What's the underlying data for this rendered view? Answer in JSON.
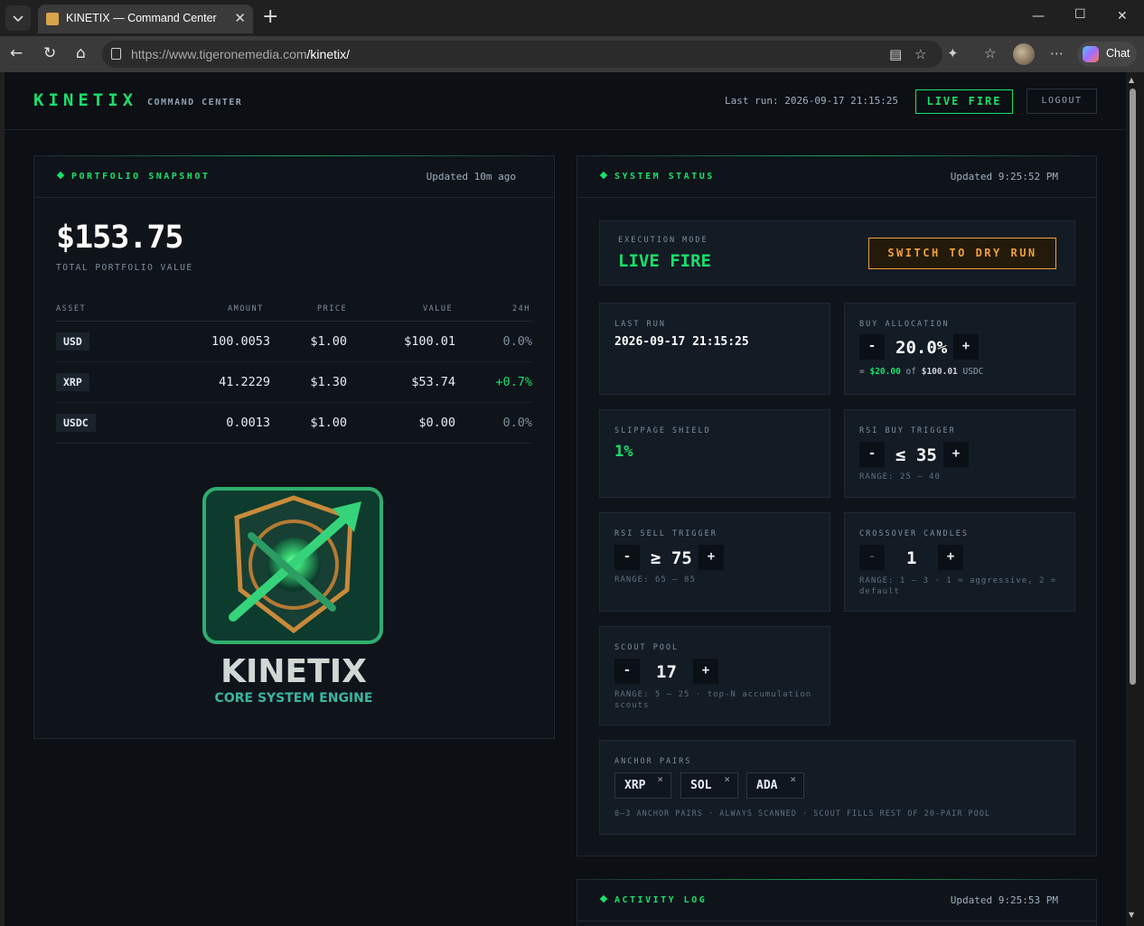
{
  "browser": {
    "tab_title": "KINETIX — Command Center",
    "url_host": "https://www.tigeronemedia.com",
    "url_path": "/kinetix/",
    "chat_label": "Chat"
  },
  "header": {
    "brand": "KINETIX",
    "subtitle": "COMMAND CENTER",
    "last_run": "Last run: 2026-09-17 21:15:25",
    "mode_button": "LIVE FIRE",
    "logout": "LOGOUT"
  },
  "portfolio": {
    "title": "PORTFOLIO SNAPSHOT",
    "updated": "Updated 10m ago",
    "total_value": "$153.75",
    "total_label": "TOTAL PORTFOLIO VALUE",
    "columns": [
      "ASSET",
      "AMOUNT",
      "PRICE",
      "VALUE",
      "24H"
    ],
    "rows": [
      {
        "asset": "USD",
        "amount": "100.0053",
        "price": "$1.00",
        "value": "$100.01",
        "change": "0.0%"
      },
      {
        "asset": "XRP",
        "amount": "41.2229",
        "price": "$1.30",
        "value": "$53.74",
        "change": "+0.7%"
      },
      {
        "asset": "USDC",
        "amount": "0.0013",
        "price": "$1.00",
        "value": "$0.00",
        "change": "0.0%"
      }
    ],
    "logo_title": "KINETIX",
    "logo_subtitle": "CORE SYSTEM ENGINE"
  },
  "status": {
    "title": "SYSTEM STATUS",
    "updated": "Updated 9:25:52 PM",
    "execution_label": "EXECUTION MODE",
    "execution_value": "LIVE FIRE",
    "switch_button": "SWITCH TO DRY RUN",
    "last_run_label": "LAST RUN",
    "last_run_value": "2026-09-17 21:15:25",
    "buy_alloc_label": "BUY ALLOCATION",
    "buy_alloc_value": "20.0%",
    "buy_alloc_prefix": "=",
    "buy_alloc_amount": "$20.00",
    "buy_alloc_of": "of",
    "buy_alloc_base": "$100.01",
    "buy_alloc_unit": "USDC",
    "slippage_label": "SLIPPAGE SHIELD",
    "slippage_value": "1%",
    "rsi_buy_label": "RSI BUY TRIGGER",
    "rsi_buy_value": "≤ 35",
    "rsi_buy_range": "RANGE: 25 – 40",
    "rsi_sell_label": "RSI SELL TRIGGER",
    "rsi_sell_value": "≥ 75",
    "rsi_sell_range": "RANGE: 65 – 85",
    "crossover_label": "CROSSOVER CANDLES",
    "crossover_value": "1",
    "crossover_range": "RANGE: 1 – 3 · 1 = aggressive, 2 = default",
    "scout_label": "SCOUT POOL",
    "scout_value": "17",
    "scout_range": "RANGE: 5 – 25 · top-N accumulation scouts",
    "anchor_label": "ANCHOR PAIRS",
    "anchor_pairs": [
      "XRP",
      "SOL",
      "ADA"
    ],
    "anchor_remove": "×",
    "anchor_note": "0–3 ANCHOR PAIRS · ALWAYS SCANNED · SCOUT FILLS REST OF 20-PAIR POOL",
    "minus": "-",
    "plus": "+"
  },
  "activity": {
    "title": "ACTIVITY LOG",
    "updated": "Updated 9:25:53 PM"
  },
  "colors": {
    "accent": "#19e06b",
    "warning": "#f0a13a",
    "background": "#0c0f14"
  }
}
